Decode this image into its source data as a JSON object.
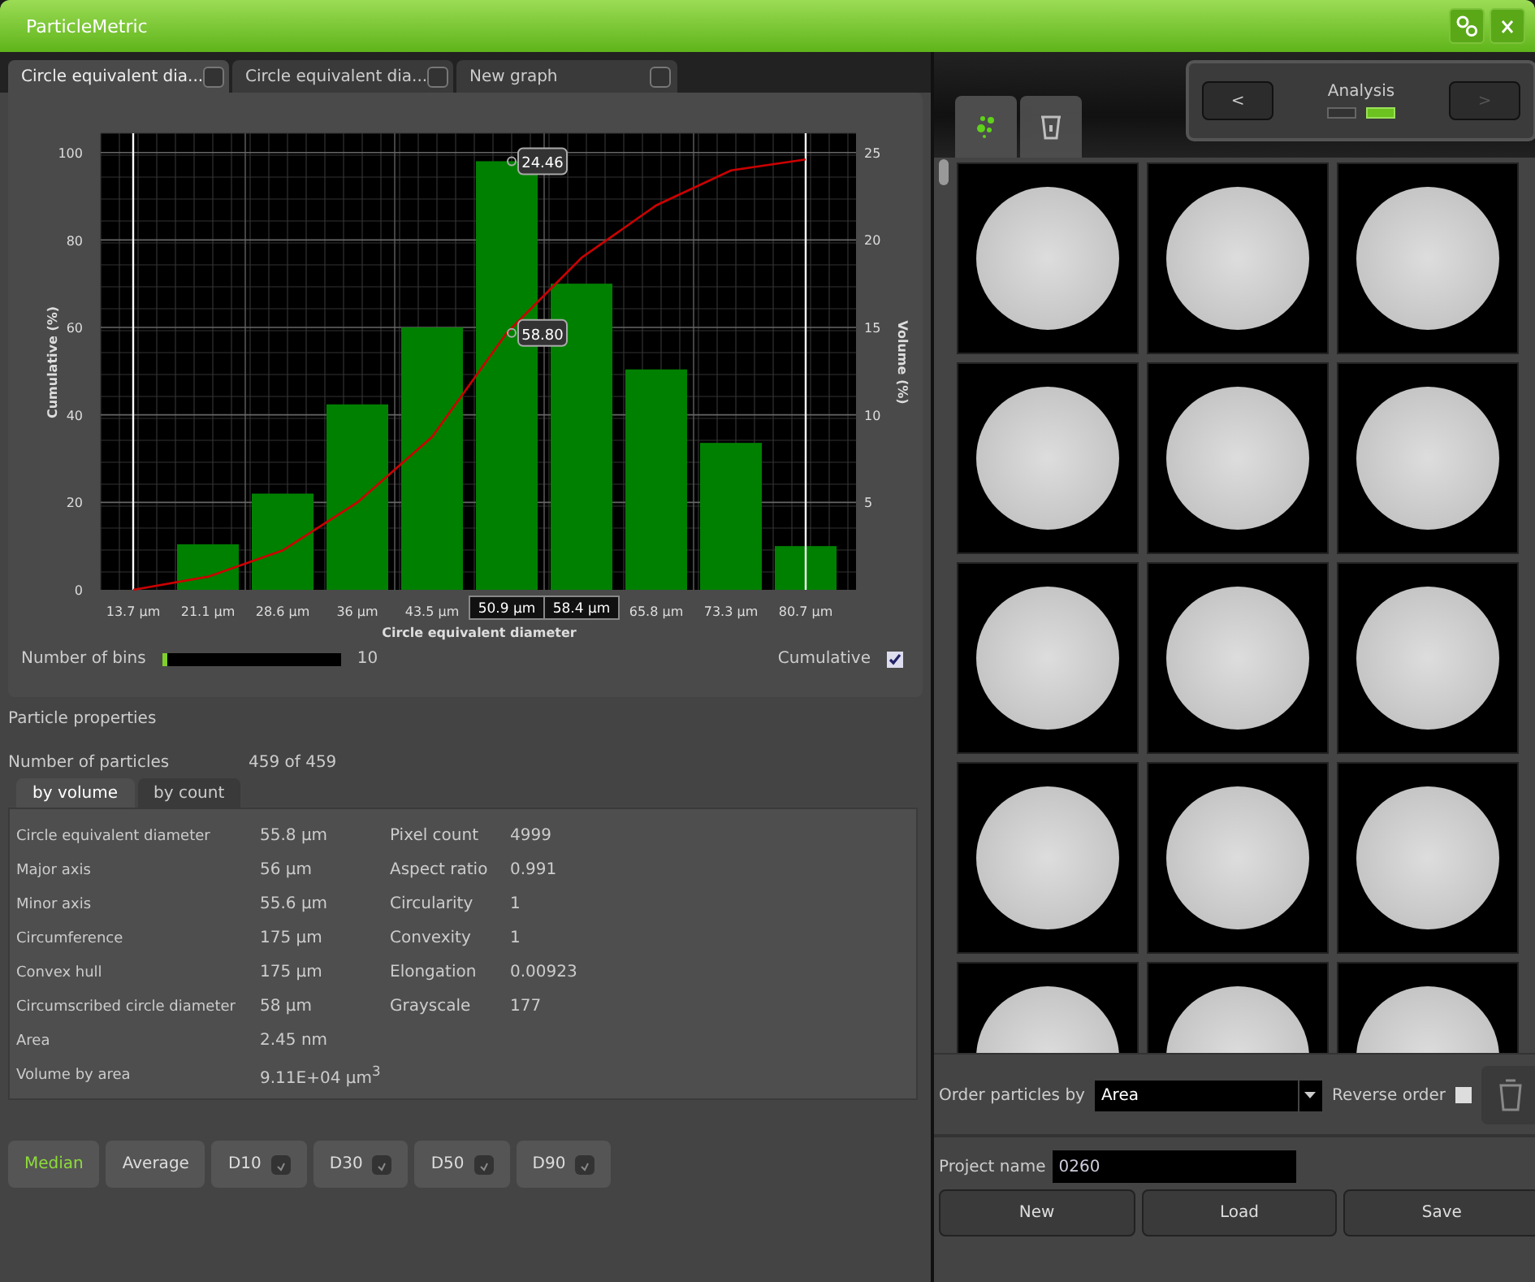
{
  "window": {
    "title": "ParticleMetric"
  },
  "graph_tabs": [
    {
      "label": "Circle equivalent dia...",
      "selected": true
    },
    {
      "label": "Circle equivalent dia...",
      "selected": false
    },
    {
      "label": "New graph",
      "selected": false
    }
  ],
  "chart": {
    "chart_data": {
      "type": "bar",
      "xlabel": "Circle equivalent diameter",
      "ylabel": "Volume (%)",
      "categories": [
        "13.7 µm",
        "21.1 µm",
        "28.6 µm",
        "36 µm",
        "43.5 µm",
        "50.9 µm",
        "58.4 µm",
        "65.8 µm",
        "73.3 µm",
        "80.7 µm"
      ],
      "series": [
        {
          "color": "#008000",
          "values": [
            0,
            2.6,
            5.5,
            10.6,
            15,
            24.5,
            17.5,
            12.6,
            8.4,
            2.5
          ]
        }
      ],
      "ylim": [
        0,
        26.1
      ],
      "yticks": [
        5,
        10,
        15,
        20,
        25
      ],
      "grid": true,
      "annotations": [
        {
          "text": "24.46",
          "x": "50.9 µm",
          "y": 24.5
        }
      ]
    },
    "cumulative_chart": {
      "chart_data": {
        "type": "line",
        "ylabel": "Cumulative (%)",
        "series": [
          {
            "color": "#cc0000",
            "values": [
              0,
              3,
              9,
              20,
              35,
              58.8,
              76,
              88,
              96,
              98.5
            ]
          }
        ],
        "ylim": [
          0,
          104.5
        ],
        "yticks": [
          0,
          20,
          40,
          60,
          80,
          100
        ],
        "annotations": [
          {
            "text": "58.80",
            "y": 58.8
          }
        ]
      }
    },
    "cursor_ticks": [
      false,
      false,
      false,
      false,
      false,
      true,
      true,
      false,
      false,
      false
    ],
    "bins_label": "Number of bins",
    "bins": {
      "level": 0.02
    },
    "bins_value": "10",
    "cumulative_label": "Cumulative",
    "cumulative_checked": true
  },
  "properties": {
    "title": "Particle properties",
    "count_label": "Number of particles",
    "count_value": "459 of 459",
    "tabs": [
      {
        "label": "by volume",
        "selected": true
      },
      {
        "label": "by count",
        "selected": false
      }
    ],
    "left_rows": [
      {
        "label": "Circle equivalent diameter",
        "value": "55.8 µm"
      },
      {
        "label": "Major axis",
        "value": "56 µm"
      },
      {
        "label": "Minor axis",
        "value": "55.6 µm"
      },
      {
        "label": "Circumference",
        "value": "175 µm"
      },
      {
        "label": "Convex hull",
        "value": "175 µm"
      },
      {
        "label": "Circumscribed circle diameter",
        "value": "58 µm"
      },
      {
        "label": "Area",
        "value": "2.45 nm"
      },
      {
        "label": "Volume by area",
        "value": "9.11E+04 µm$^{3}$"
      }
    ],
    "right_rows": [
      {
        "label": "Pixel count",
        "value": "4999"
      },
      {
        "label": "Aspect ratio",
        "value": "0.991"
      },
      {
        "label": "Circularity",
        "value": "1"
      },
      {
        "label": "Convexity",
        "value": "1"
      },
      {
        "label": "Elongation",
        "value": "0.00923"
      },
      {
        "label": "Grayscale",
        "value": "177"
      }
    ]
  },
  "statistics": [
    {
      "label": "Median",
      "selected": true,
      "kind": "plain"
    },
    {
      "label": "Average",
      "selected": false,
      "kind": "plain"
    },
    {
      "label": "D10",
      "selected": false,
      "kind": "check",
      "checked": true
    },
    {
      "label": "D30",
      "selected": false,
      "kind": "check",
      "checked": true
    },
    {
      "label": "D50",
      "selected": false,
      "kind": "check",
      "checked": true
    },
    {
      "label": "D90",
      "selected": false,
      "kind": "check",
      "checked": true
    }
  ],
  "analysis_nav": {
    "prev": "<",
    "title": "Analysis",
    "next": ">",
    "next_disabled": true,
    "steps": [
      {
        "selected": false
      },
      {
        "selected": true
      }
    ]
  },
  "view_buttons": [
    {
      "kind": "particles",
      "selected": true
    },
    {
      "kind": "trash",
      "selected": false
    }
  ],
  "order": {
    "label": "Order particles by",
    "value": "Area",
    "reverse_label": "Reverse order",
    "reverse_checked": false
  },
  "project": {
    "label": "Project name",
    "value": "0260"
  },
  "project_buttons": [
    "New",
    "Load",
    "Save"
  ]
}
